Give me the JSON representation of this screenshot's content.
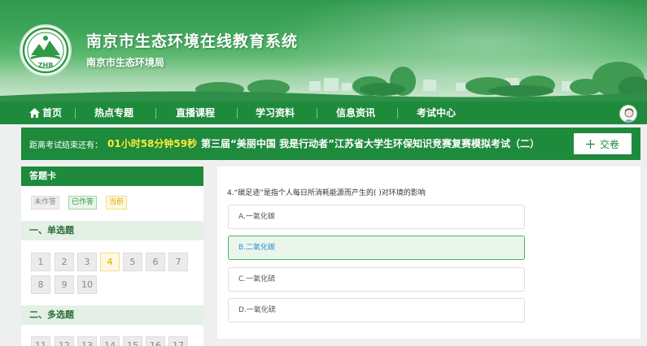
{
  "header": {
    "site_title": "南京市生态环境在线教育系统",
    "site_subtitle": "南京市生态环境局",
    "logo_text": "ZHB"
  },
  "nav": {
    "items": [
      {
        "label": "首页",
        "icon": "home-icon"
      },
      {
        "label": "热点专题"
      },
      {
        "label": "直播课程"
      },
      {
        "label": "学习资料"
      },
      {
        "label": "信息资讯"
      },
      {
        "label": "考试中心"
      }
    ]
  },
  "exam": {
    "countdown_label": "距离考试结束还有：",
    "countdown": "01小时58分钟59秒",
    "title": "第三届“美丽中国 我是行动者”江苏省大学生环保知识竞赛复赛模拟考试（二）",
    "submit_label": "交卷",
    "submit_icon": "plus-icon"
  },
  "answer_card": {
    "title": "答题卡",
    "legend": {
      "undone": "未作答",
      "done": "已作答",
      "current": "当前"
    },
    "sections": [
      {
        "title": "一、单选题",
        "questions": [
          "1",
          "2",
          "3",
          "4",
          "5",
          "6",
          "7",
          "8",
          "9",
          "10"
        ],
        "current": "4"
      },
      {
        "title": "二、多选题",
        "questions": [
          "11",
          "12",
          "13",
          "14",
          "15",
          "16",
          "17"
        ]
      }
    ]
  },
  "question": {
    "text": "4.“碳足迹”是指个人每日所消耗能源而产生的( )对环境的影响",
    "options": [
      "A.一氧化碳",
      "B.二氧化碳",
      "C.一氧化硫",
      "D.一氧化硫"
    ],
    "selected_index": 1
  },
  "colors": {
    "brand_green": "#1e8a3c",
    "countdown_yellow": "#ffeb3b",
    "current_orange": "#e0a800",
    "selected_text_blue": "#2d8fd6"
  }
}
